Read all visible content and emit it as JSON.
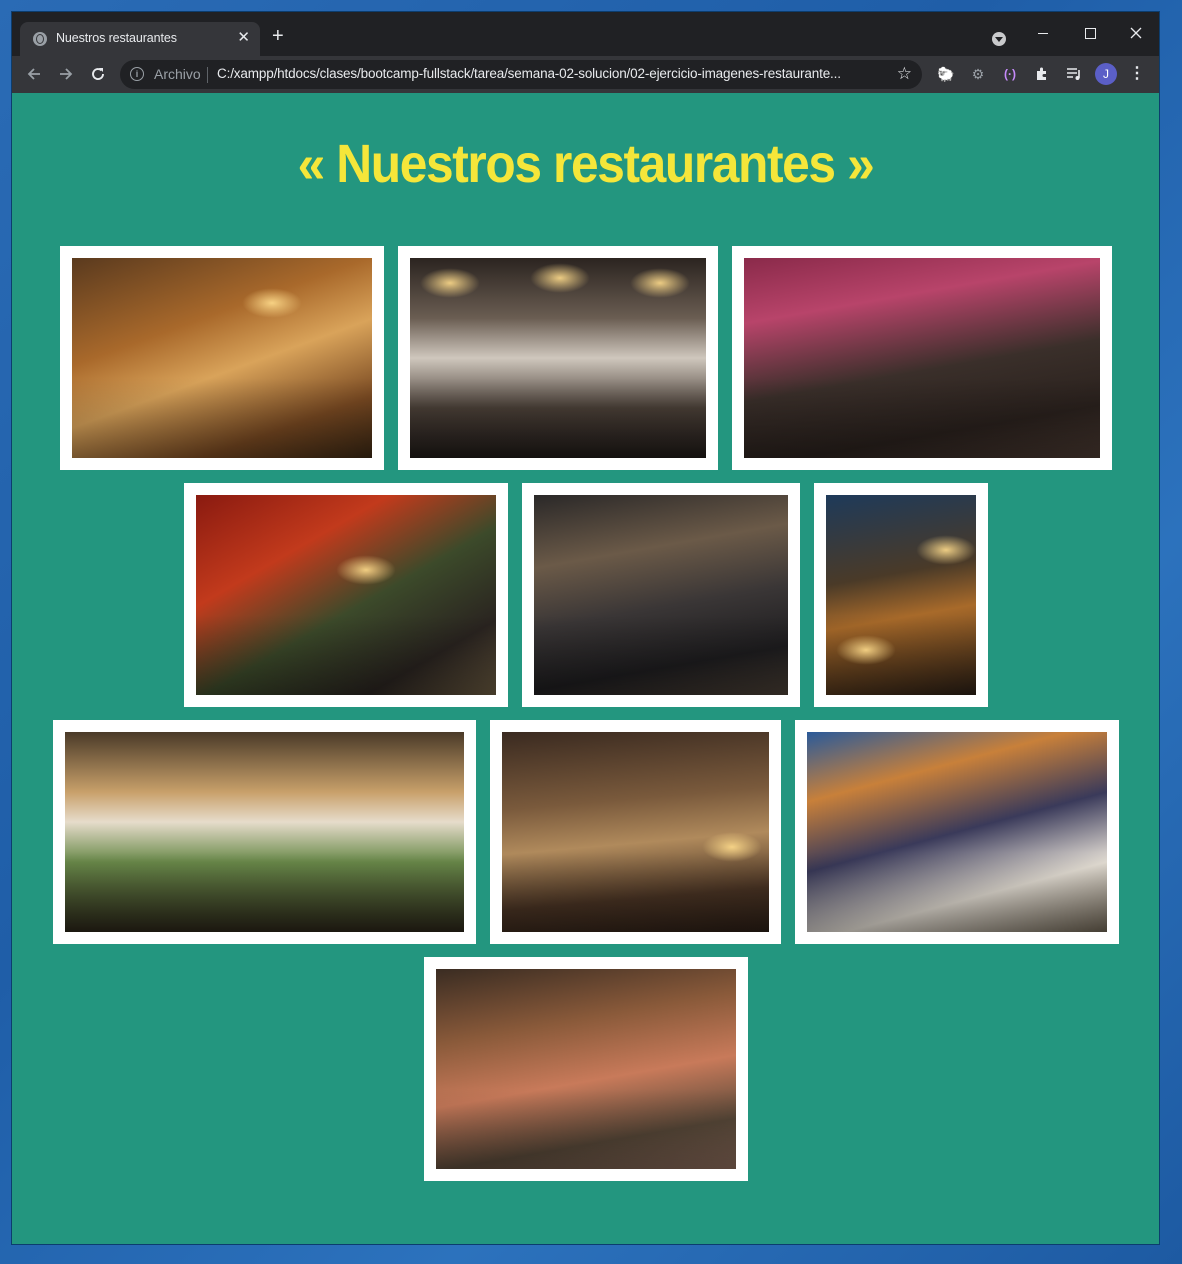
{
  "browser": {
    "tab_title": "Nuestros restaurantes",
    "tab_close": "✕",
    "new_tab": "+",
    "security_label": "Archivo",
    "url": "C:/xampp/htdocs/clases/bootcamp-fullstack/tarea/semana-02-solucion/02-ejercicio-imagenes-restaurante...",
    "profile_initial": "J",
    "icons": [
      "back-arrow-icon",
      "forward-arrow-icon",
      "reload-icon",
      "info-icon",
      "star-icon",
      "puzzle-extensions-icon",
      "media-queue-icon",
      "kebab-menu-icon"
    ]
  },
  "page": {
    "heading": "« Nuestros restaurantes »",
    "heading_color": "#f5e63a",
    "background_color": "#23967f"
  },
  "gallery": {
    "image_count": 10
  }
}
